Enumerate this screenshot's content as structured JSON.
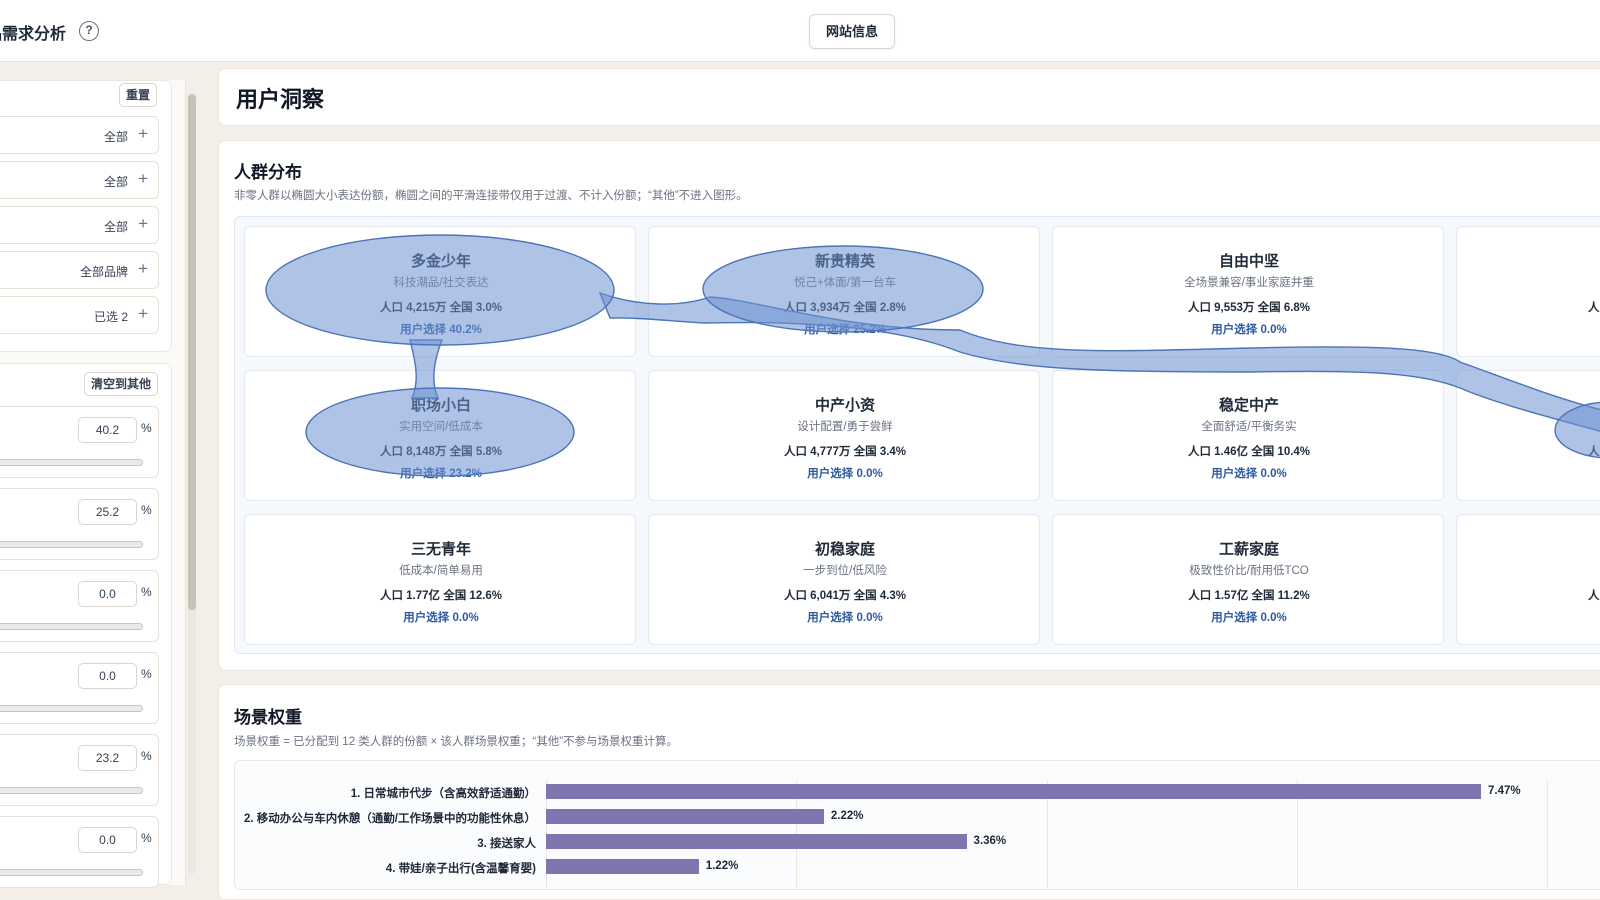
{
  "header": {
    "title": "品需求分析",
    "help": "?",
    "site_info": "网站信息"
  },
  "sidebar": {
    "reset": "重置",
    "filters": [
      {
        "value": "全部",
        "plus": "+"
      },
      {
        "value": "全部",
        "plus": "+"
      },
      {
        "value": "全部",
        "plus": "+"
      },
      {
        "value": "全部品牌",
        "plus": "+"
      },
      {
        "value": "已选 2",
        "plus": "+"
      }
    ],
    "clear_to_other": "清空到其他",
    "shares": [
      {
        "value": "40.2",
        "unit": "%"
      },
      {
        "value": "25.2",
        "unit": "%"
      },
      {
        "value": "0.0",
        "unit": "%"
      },
      {
        "value": "0.0",
        "unit": "%"
      },
      {
        "value": "23.2",
        "unit": "%"
      },
      {
        "value": "0.0",
        "unit": "%"
      }
    ]
  },
  "main": {
    "insight_title": "用户洞察",
    "crowd": {
      "title": "人群分布",
      "desc": "非零人群以椭圆大小表达份额，椭圆之间的平滑连接带仅用于过渡、不计入份额；“其他”不进入图形。",
      "cards": [
        {
          "name": "多金少年",
          "tag": "科技潮品/社交表达",
          "pop": "人口 4,215万  全国 3.0%",
          "sel": "用户选择 40.2%"
        },
        {
          "name": "新贵精英",
          "tag": "悦己+体面/第一台车",
          "pop": "人口 3,934万  全国 2.8%",
          "sel": "用户选择 25.2%"
        },
        {
          "name": "自由中坚",
          "tag": "全场景兼容/事业家庭并重",
          "pop": "人口 9,553万  全国 6.8%",
          "sel": "用户选择 0.0%"
        },
        {
          "name": "",
          "tag": "",
          "pop": "人",
          "sel": ""
        },
        {
          "name": "职场小白",
          "tag": "实用空间/低成本",
          "pop": "人口 8,148万  全国 5.8%",
          "sel": "用户选择 23.2%"
        },
        {
          "name": "中产小资",
          "tag": "设计配置/勇于尝鲜",
          "pop": "人口 4,777万  全国 3.4%",
          "sel": "用户选择 0.0%"
        },
        {
          "name": "稳定中产",
          "tag": "全面舒适/平衡务实",
          "pop": "人口 1.46亿  全国 10.4%",
          "sel": "用户选择 0.0%"
        },
        {
          "name": "",
          "tag": "",
          "pop": "人",
          "sel": ""
        },
        {
          "name": "三无青年",
          "tag": "低成本/简单易用",
          "pop": "人口 1.77亿  全国 12.6%",
          "sel": "用户选择 0.0%"
        },
        {
          "name": "初稳家庭",
          "tag": "一步到位/低风险",
          "pop": "人口 6,041万  全国 4.3%",
          "sel": "用户选择 0.0%"
        },
        {
          "name": "工薪家庭",
          "tag": "极致性价比/耐用低TCO",
          "pop": "人口 1.57亿  全国 11.2%",
          "sel": "用户选择 0.0%"
        },
        {
          "name": "",
          "tag": "",
          "pop": "人",
          "sel": ""
        }
      ]
    },
    "scenario": {
      "title": "场景权重",
      "desc": "场景权重 = 已分配到 12 类人群的份额 × 该人群场景权重；“其他”不参与场景权重计算。",
      "chart_data": {
        "type": "bar",
        "orientation": "horizontal",
        "categories": [
          "1. 日常城市代步（含高效舒适通勤）",
          "2. 移动办公与车内休憩（通勤/工作场景中的功能性休息）",
          "3. 接送家人",
          "4. 带娃/亲子出行(含温馨育婴)"
        ],
        "values": [
          7.47,
          2.22,
          3.36,
          1.22
        ],
        "value_labels": [
          "7.47%",
          "2.22%",
          "3.36%",
          "1.22%"
        ],
        "color": "#8175b0",
        "grid": true
      }
    }
  }
}
